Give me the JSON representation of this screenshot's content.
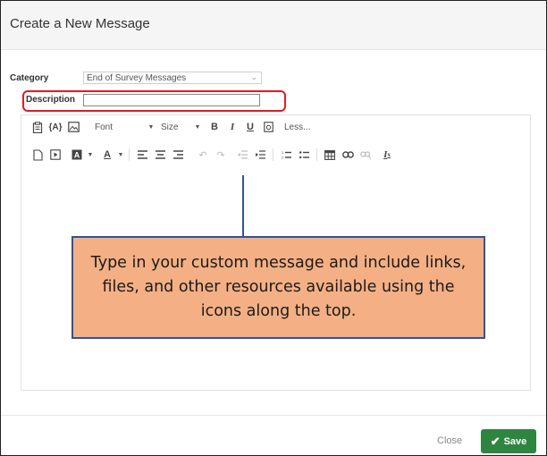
{
  "dialog": {
    "title": "Create a New Message"
  },
  "form": {
    "category_label": "Category",
    "category_value": "End of Survey Messages",
    "description_label": "Description",
    "description_value": ""
  },
  "toolbar": {
    "row1": {
      "font_label": "Font",
      "size_label": "Size",
      "bold_label": "B",
      "italic_label": "I",
      "underline_label": "U",
      "less_label": "Less..."
    },
    "row2": {
      "text_color_label": "A",
      "clear_format_label": "I",
      "clear_format_sub": "x"
    }
  },
  "callout": {
    "text": "Type in your custom message and include links, files, and other resources available using the icons along the top."
  },
  "colors": {
    "save_button": "#2e8540",
    "highlight": "#e21b23",
    "callout_fill": "#f4b084",
    "callout_border": "#2f5496"
  },
  "footer": {
    "close_label": "Close",
    "save_label": "Save"
  }
}
